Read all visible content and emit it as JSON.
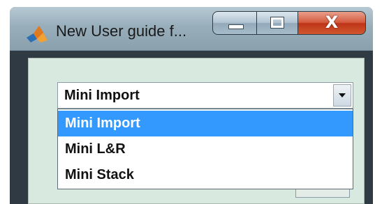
{
  "window": {
    "title": "New User guide f...",
    "app_icon": "matlab-logo-icon",
    "controls": {
      "minimize_icon": "minimize-icon",
      "maximize_icon": "maximize-icon",
      "close_icon": "close-icon",
      "close_glyph": "X"
    }
  },
  "dropdown": {
    "selected_value": "Mini Import",
    "options": [
      "Mini Import",
      "Mini L&R",
      "Mini Stack"
    ],
    "highlighted_index": 0,
    "arrow_icon": "caret-down-icon"
  },
  "colors": {
    "highlight": "#3399ff",
    "client_bg": "#d8eadf",
    "close_button": "#c73a1c"
  }
}
